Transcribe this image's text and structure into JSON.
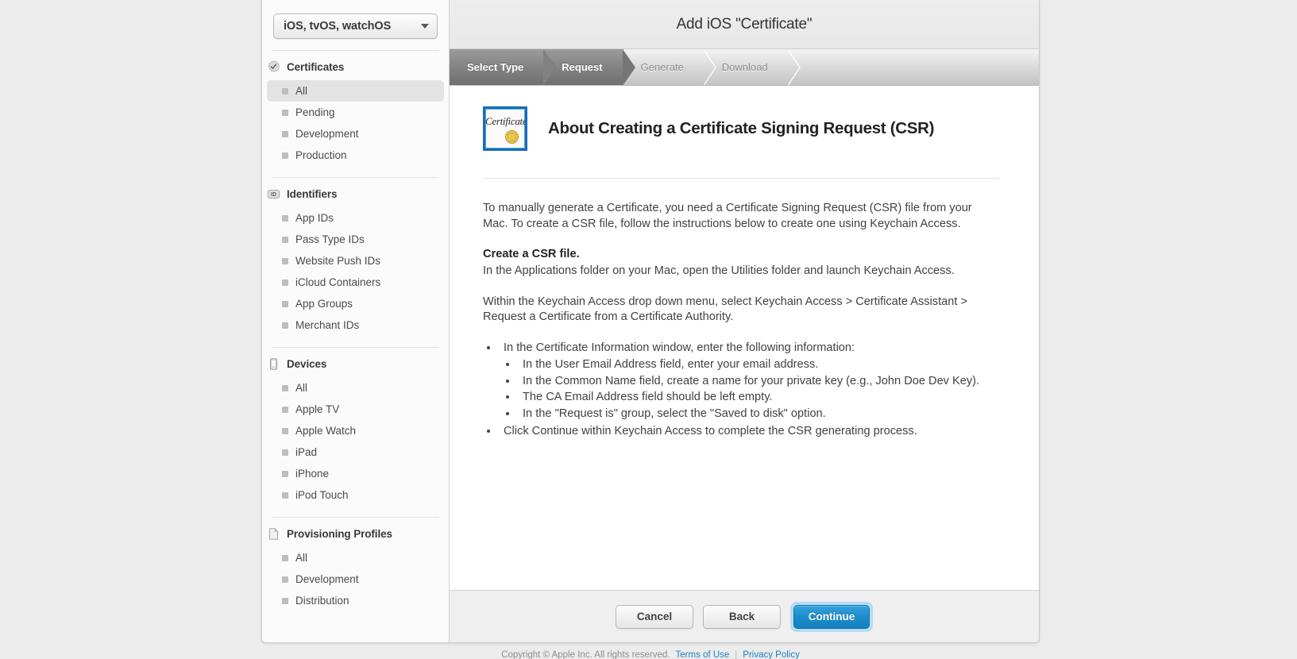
{
  "sidebar": {
    "platform_select": {
      "value": "iOS, tvOS, watchOS",
      "icon": "chevron-down-icon"
    },
    "sections": [
      {
        "label": "Certificates",
        "icon": "certificate-badge-icon",
        "items": [
          {
            "label": "All",
            "selected": true
          },
          {
            "label": "Pending",
            "selected": false
          },
          {
            "label": "Development",
            "selected": false
          },
          {
            "label": "Production",
            "selected": false
          }
        ]
      },
      {
        "label": "Identifiers",
        "icon": "id-badge-icon",
        "items": [
          {
            "label": "App IDs",
            "selected": false
          },
          {
            "label": "Pass Type IDs",
            "selected": false
          },
          {
            "label": "Website Push IDs",
            "selected": false
          },
          {
            "label": "iCloud Containers",
            "selected": false
          },
          {
            "label": "App Groups",
            "selected": false
          },
          {
            "label": "Merchant IDs",
            "selected": false
          }
        ]
      },
      {
        "label": "Devices",
        "icon": "device-phone-icon",
        "items": [
          {
            "label": "All",
            "selected": false
          },
          {
            "label": "Apple TV",
            "selected": false
          },
          {
            "label": "Apple Watch",
            "selected": false
          },
          {
            "label": "iPad",
            "selected": false
          },
          {
            "label": "iPhone",
            "selected": false
          },
          {
            "label": "iPod Touch",
            "selected": false
          }
        ]
      },
      {
        "label": "Provisioning Profiles",
        "icon": "document-page-icon",
        "items": [
          {
            "label": "All",
            "selected": false
          },
          {
            "label": "Development",
            "selected": false
          },
          {
            "label": "Distribution",
            "selected": false
          }
        ]
      }
    ]
  },
  "header": {
    "title": "Add iOS \"Certificate\""
  },
  "steps": [
    {
      "label": "Select Type",
      "state": "active"
    },
    {
      "label": "Request",
      "state": "active"
    },
    {
      "label": "Generate",
      "state": "inactive"
    },
    {
      "label": "Download",
      "state": "inactive"
    }
  ],
  "main": {
    "hero_icon": {
      "name": "certificate-document-icon",
      "word": "Certificate"
    },
    "hero_title": "About Creating a Certificate Signing Request (CSR)",
    "paragraph_1": "To manually generate a Certificate, you need a Certificate Signing Request (CSR) file from your Mac. To create a CSR file, follow the instructions below to create one using Keychain Access.",
    "subheading": "Create a CSR file.",
    "paragraph_2": "In the Applications folder on your Mac, open the Utilities folder and launch Keychain Access.",
    "paragraph_3": "Within the Keychain Access drop down menu, select Keychain Access > Certificate Assistant > Request a Certificate from a Certificate Authority.",
    "bullets": [
      {
        "text": "In the Certificate Information window, enter the following information:",
        "children": [
          "In the User Email Address field, enter your email address.",
          "In the Common Name field, create a name for your private key (e.g., John Doe Dev Key).",
          "The CA Email Address field should be left empty.",
          "In the \"Request is\" group, select the \"Saved to disk\" option."
        ]
      },
      {
        "text": "Click Continue within Keychain Access to complete the CSR generating process.",
        "children": []
      }
    ]
  },
  "buttons": {
    "cancel": "Cancel",
    "back": "Back",
    "continue": "Continue"
  },
  "footer": {
    "copyright": "Copyright © Apple Inc. All rights reserved.",
    "terms": "Terms of Use",
    "separator": "|",
    "privacy": "Privacy Policy"
  },
  "colors": {
    "accent_blue": "#1f8ecb",
    "focus_ring": "#b7dcf4",
    "step_active": "#818181",
    "link_blue": "#1b82c4"
  }
}
